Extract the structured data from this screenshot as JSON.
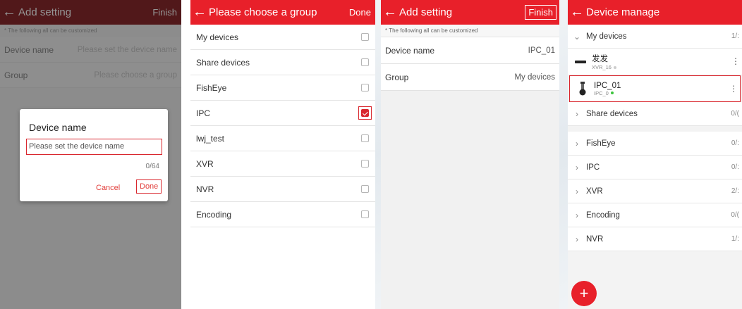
{
  "panel1": {
    "header": {
      "title": "Add setting",
      "right": "Finish"
    },
    "hint": "* The following all can be customized",
    "rows": [
      {
        "label": "Device name",
        "placeholder": "Please set the device name"
      },
      {
        "label": "Group",
        "placeholder": "Please choose a group"
      }
    ],
    "dialog": {
      "title": "Device name",
      "placeholder": "Please set the device name",
      "counter": "0/64",
      "cancel": "Cancel",
      "done": "Done"
    }
  },
  "panel2": {
    "header": {
      "title": "Please choose a group",
      "right": "Done"
    },
    "groups": [
      {
        "label": "My devices",
        "checked": false
      },
      {
        "label": "Share devices",
        "checked": false
      },
      {
        "label": "FishEye",
        "checked": false
      },
      {
        "label": "IPC",
        "checked": true
      },
      {
        "label": "lwj_test",
        "checked": false
      },
      {
        "label": "XVR",
        "checked": false
      },
      {
        "label": "NVR",
        "checked": false
      },
      {
        "label": "Encoding",
        "checked": false
      }
    ]
  },
  "panel3": {
    "header": {
      "title": "Add setting",
      "right": "Finish"
    },
    "hint": "* The following all can be customized",
    "rows": [
      {
        "label": "Device name",
        "value": "IPC_01"
      },
      {
        "label": "Group",
        "value": "My devices"
      }
    ]
  },
  "panel4": {
    "header": {
      "title": "Device manage"
    },
    "my_devices": {
      "label": "My devices",
      "count": "1/:"
    },
    "devices": [
      {
        "name": "发发",
        "sub": "XVR_16",
        "status_color": "#cccccc"
      },
      {
        "name": "IPC_01",
        "sub": "IPC_0",
        "status_color": "#3cc43c"
      }
    ],
    "categories": [
      {
        "label": "Share devices",
        "count": "0/("
      },
      {
        "label": "FishEye",
        "count": "0/:"
      },
      {
        "label": "IPC",
        "count": "0/:"
      },
      {
        "label": "XVR",
        "count": "2/:"
      },
      {
        "label": "Encoding",
        "count": "0/("
      },
      {
        "label": "NVR",
        "count": "1/:"
      }
    ],
    "fab": "+"
  },
  "colors": {
    "accent": "#e8202a",
    "highlight": "#d9272e"
  }
}
